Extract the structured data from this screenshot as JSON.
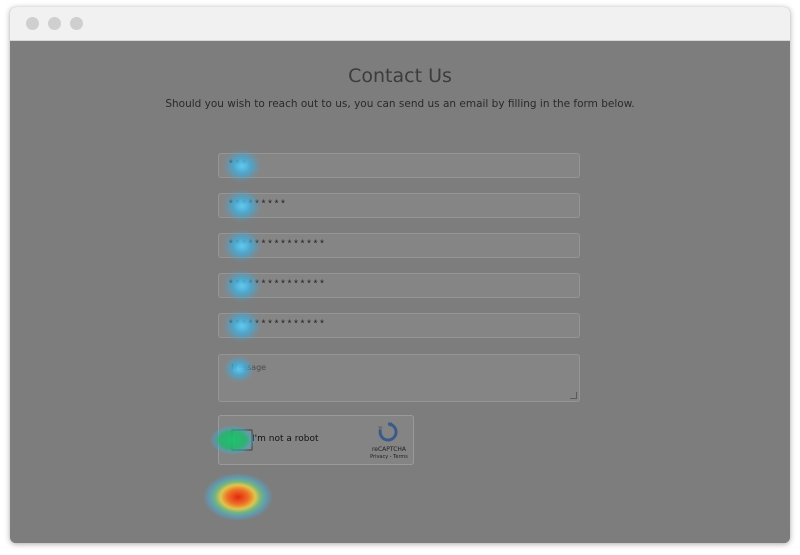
{
  "page": {
    "title": "Contact Us",
    "subtitle": "Should you wish to reach out to us, you can send us an email by filling in the form below."
  },
  "form": {
    "fields": [
      {
        "value": "***"
      },
      {
        "value": "*********"
      },
      {
        "value": "***************"
      },
      {
        "value": "***************"
      },
      {
        "value": "***************"
      }
    ],
    "message_placeholder": "Message"
  },
  "captcha": {
    "label": "I'm not a robot",
    "brand": "reCAPTCHA",
    "links": "Privacy - Terms"
  },
  "colors": {
    "overlay": "#7d7d7d",
    "titlebar": "#f1f1f1",
    "heat_blue": "#5fcdf5",
    "heat_green": "#1ec36e",
    "heat_red": "#e12814"
  }
}
